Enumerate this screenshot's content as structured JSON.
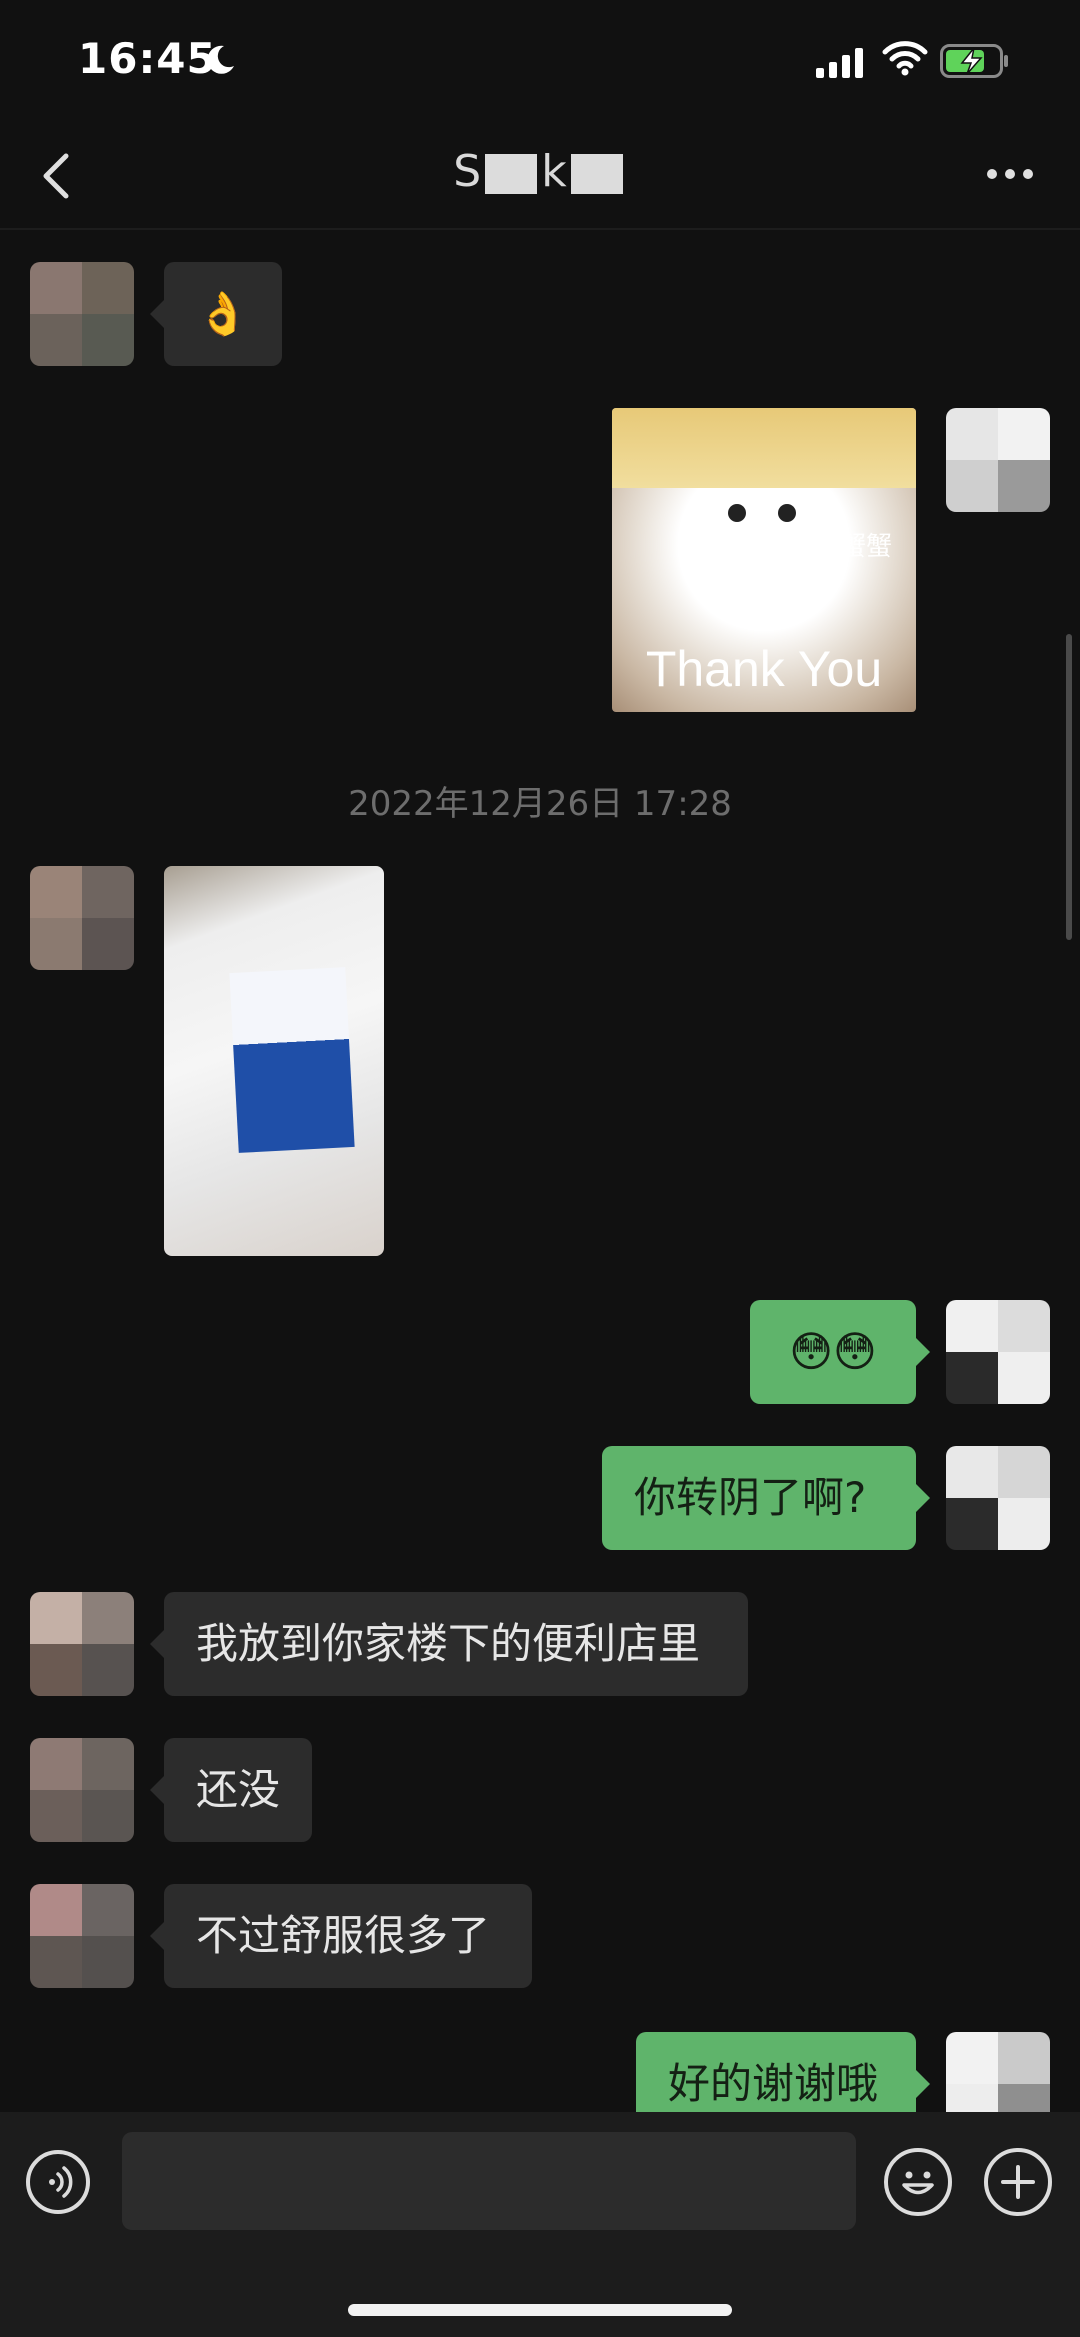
{
  "status_bar": {
    "time": "16:45",
    "icons": [
      "moon-icon",
      "signal-icon",
      "wifi-icon",
      "battery-charging-icon"
    ]
  },
  "header": {
    "title_prefix": "S",
    "title_suffix": "k",
    "icons": [
      "back-chevron-icon",
      "more-dots-icon"
    ]
  },
  "messages": {
    "m1": {
      "sender": "contact",
      "content": "👌"
    },
    "m2": {
      "sender": "me",
      "sticker_big_text": "Thank You",
      "sticker_small_text": "蟹蟹"
    },
    "timestamp": "2022年12月26日 17:28",
    "m3": {
      "sender": "contact",
      "type": "photo"
    },
    "m4": {
      "sender": "me",
      "content": "😳😳"
    },
    "m5": {
      "sender": "me",
      "content": "你转阴了啊?"
    },
    "m6": {
      "sender": "contact",
      "content": "我放到你家楼下的便利店里"
    },
    "m7": {
      "sender": "contact",
      "content": "还没"
    },
    "m8": {
      "sender": "contact",
      "content": "不过舒服很多了"
    },
    "m9": {
      "sender": "me",
      "content": "好的谢谢哦"
    }
  },
  "input_bar": {
    "icons": [
      "voice-icon",
      "emoji-icon",
      "plus-icon"
    ]
  },
  "colors": {
    "background": "#111111",
    "incoming_bubble": "#2c2c2c",
    "outgoing_bubble": "#5fb46b",
    "timestamp": "#6d6d6d"
  }
}
